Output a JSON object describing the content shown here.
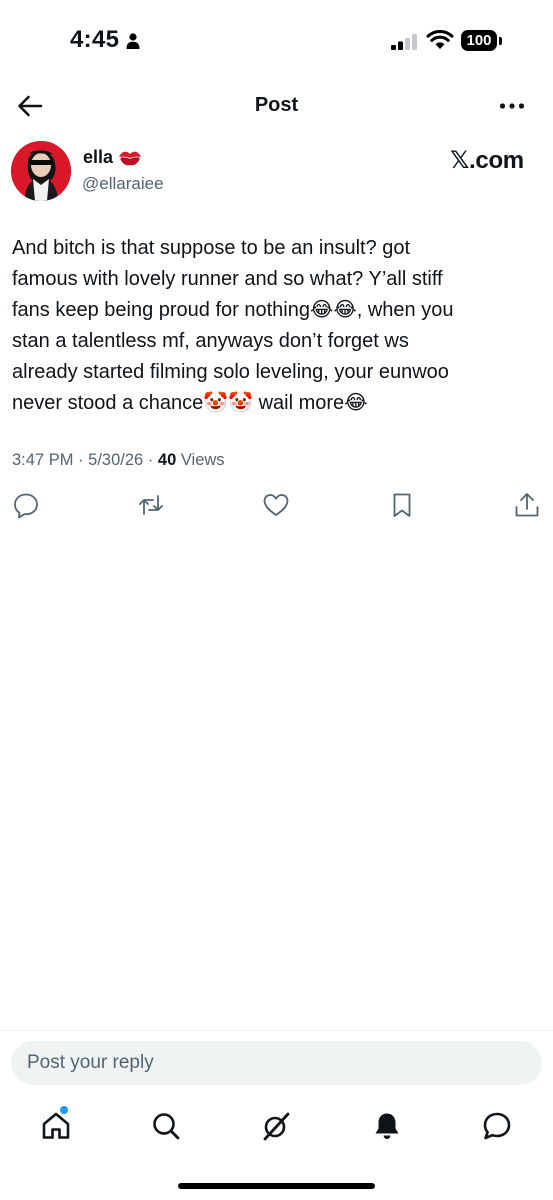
{
  "status_bar": {
    "time": "4:45",
    "battery": "100"
  },
  "header": {
    "title": "Post"
  },
  "post": {
    "author": {
      "name": "ella",
      "handle": "@ellaraiee",
      "name_emoji": "💋"
    },
    "source": "𝕏.com",
    "text": "And bitch is that suppose to be an insult? got\nfamous with lovely runner and so what? Y’all stiff\nfans keep being proud for nothing😂😂, when you\nstan a talentless mf, anyways don’t forget ws\nalready started filming solo leveling, your eunwoo\nnever stood a chance🤡🤡 wail more😂",
    "time": "3:47 PM",
    "date": "5/30/26",
    "separator": "·",
    "views_count": "40",
    "views_label": "Views"
  },
  "actions": [
    "reply-icon",
    "repost-icon",
    "like-icon",
    "bookmark-icon",
    "share-icon"
  ],
  "reply": {
    "placeholder": "Post your reply"
  },
  "bottom_nav": {
    "tabs": [
      "home-icon",
      "search-icon",
      "grok-icon",
      "notifications-icon",
      "messages-icon"
    ],
    "home_has_badge": true
  },
  "colors": {
    "text": "#0f1419",
    "secondary": "#536471",
    "accent": "#1d9bf0",
    "avatar_bg": "#d9192a",
    "reply_bg": "#eff3f4"
  }
}
